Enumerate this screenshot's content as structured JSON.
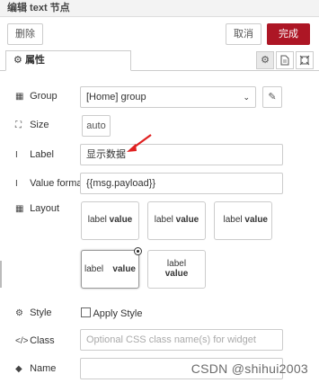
{
  "window": {
    "title": "编辑 text 节点"
  },
  "toolbar": {
    "delete_label": "删除",
    "cancel_label": "取消",
    "done_label": "完成"
  },
  "tabs": {
    "properties_label": "属性",
    "properties_icon": "gear-icon"
  },
  "form": {
    "group": {
      "label": "Group",
      "value": "[Home] group"
    },
    "size": {
      "label": "Size",
      "value": "auto"
    },
    "label": {
      "label": "Label",
      "value": "显示数据"
    },
    "value_format": {
      "label": "Value format",
      "value": "{{msg.payload}}"
    },
    "layout": {
      "label": "Layout",
      "options": [
        {
          "label": "label",
          "value": "value"
        },
        {
          "label": "label",
          "value": "value"
        },
        {
          "label": "label",
          "value": "value"
        },
        {
          "label": "label",
          "value": "value",
          "selected": true
        },
        {
          "label": "label",
          "value": "value"
        }
      ]
    },
    "style": {
      "label": "Style",
      "checkbox_label": "Apply Style"
    },
    "class": {
      "label": "Class",
      "placeholder": "Optional CSS class name(s) for widget"
    },
    "name": {
      "label": "Name",
      "value": ""
    }
  },
  "watermark": "CSDN @shihui2003",
  "colors": {
    "primary": "#ad1625",
    "annotation_arrow": "#e02020"
  }
}
